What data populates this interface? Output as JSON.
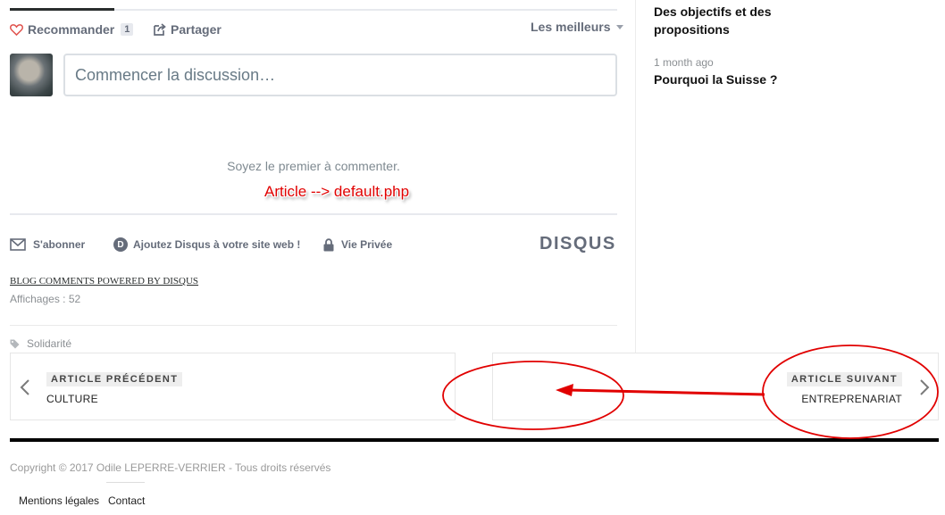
{
  "actions": {
    "recommend_label": "Recommander",
    "recommend_count": "1",
    "share_label": "Partager",
    "sort_label": "Les meilleurs"
  },
  "comment": {
    "placeholder": "Commencer la discussion…",
    "empty_message": "Soyez le premier à commenter."
  },
  "annotation": {
    "text": "Article --> default.php",
    "color": "#e10000"
  },
  "disqus_footer": {
    "subscribe": "S'abonner",
    "add_disqus": "Ajoutez Disqus à votre site web !",
    "add_disqus_icon_letter": "D",
    "privacy": "Vie Privée",
    "logo": "DISQUS"
  },
  "powered_by": "BLOG COMMENTS POWERED BY DISQUS",
  "views": "Affichages : 52",
  "tag": "Solidarité",
  "sidebar": {
    "item1_title": "Des objectifs et des propositions",
    "item2_meta": "1 month ago",
    "item2_title": "Pourquoi la Suisse ?"
  },
  "nav": {
    "prev_badge": "ARTICLE PRÉCÉDENT",
    "prev_title": "CULTURE",
    "next_badge": "ARTICLE SUIVANT",
    "next_title": "ENTREPRENARIAT"
  },
  "footer": {
    "copyright": "Copyright © 2017 Odile LEPERRE-VERRIER - Tous droits réservés",
    "legal": "Mentions légales",
    "contact": "Contact"
  },
  "icons": {
    "heart": "heart-icon",
    "share": "share-icon",
    "caret": "chevron-down-icon",
    "mail": "mail-icon",
    "disqus": "disqus-d-icon",
    "lock": "lock-icon",
    "tag": "tag-icon",
    "prev": "chevron-left-icon",
    "next": "chevron-right-icon"
  },
  "colors": {
    "accent_red": "#e10000",
    "disqus_gray": "#656c7a",
    "heart_red": "#e0534e"
  }
}
